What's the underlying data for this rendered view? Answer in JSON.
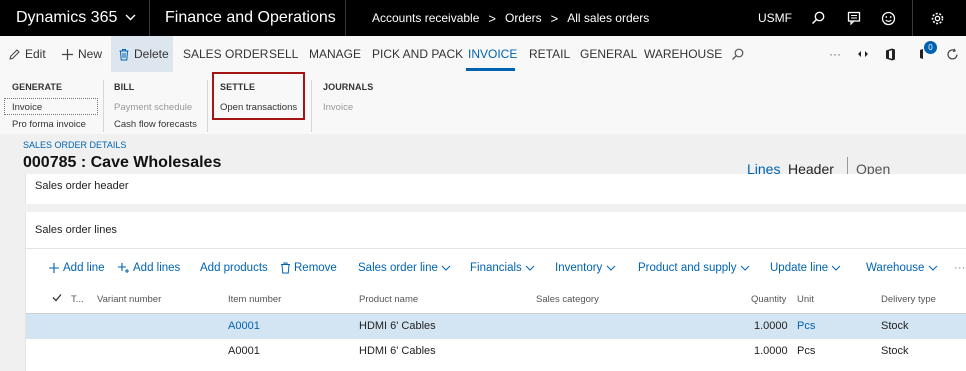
{
  "topbar": {
    "app_title": "Dynamics 365",
    "module": "Finance and Operations",
    "breadcrumb": [
      "Accounts receivable",
      "Orders",
      "All sales orders"
    ],
    "company": "USMF"
  },
  "actionbar": {
    "edit": "Edit",
    "new": "New",
    "delete": "Delete",
    "tabs": [
      "SALES ORDER",
      "SELL",
      "MANAGE",
      "PICK AND PACK",
      "INVOICE",
      "RETAIL",
      "GENERAL",
      "WAREHOUSE"
    ],
    "active_tab": "INVOICE",
    "more": "···",
    "notification_count": "0"
  },
  "ribbon": {
    "generate": {
      "title": "GENERATE",
      "items": [
        "Invoice",
        "Pro forma invoice"
      ]
    },
    "bill": {
      "title": "BILL",
      "items": [
        "Payment schedule",
        "Cash flow forecasts"
      ]
    },
    "settle": {
      "title": "SETTLE",
      "items": [
        "Open transactions"
      ]
    },
    "journals": {
      "title": "JOURNALS",
      "items": [
        "Invoice"
      ]
    }
  },
  "details": {
    "label": "SALES ORDER DETAILS",
    "title": "000785 : Cave Wholesales",
    "view_lines": "Lines",
    "view_header": "Header",
    "status": "Open order"
  },
  "header_panel": {
    "title": "Sales order header"
  },
  "lines_panel": {
    "title": "Sales order lines",
    "toolbar": {
      "add_line": "Add line",
      "add_lines": "Add lines",
      "add_products": "Add products",
      "remove": "Remove",
      "menus": [
        "Sales order line",
        "Financials",
        "Inventory",
        "Product and supply",
        "Update line",
        "Warehouse"
      ],
      "more": "···"
    },
    "columns": [
      "T...",
      "Variant number",
      "Item number",
      "Product name",
      "Sales category",
      "Quantity",
      "Unit",
      "Delivery type"
    ],
    "rows": [
      {
        "item_number": "A0001",
        "product_name": "HDMI 6' Cables",
        "quantity": "1.0000",
        "unit": "Pcs",
        "delivery_type": "Stock"
      },
      {
        "item_number": "A0001",
        "product_name": "HDMI 6' Cables",
        "quantity": "1.0000",
        "unit": "Pcs",
        "delivery_type": "Stock"
      }
    ]
  },
  "colors": {
    "accent": "#0063b1",
    "highlight": "#a31515",
    "selected_row": "#d3e4f3"
  }
}
